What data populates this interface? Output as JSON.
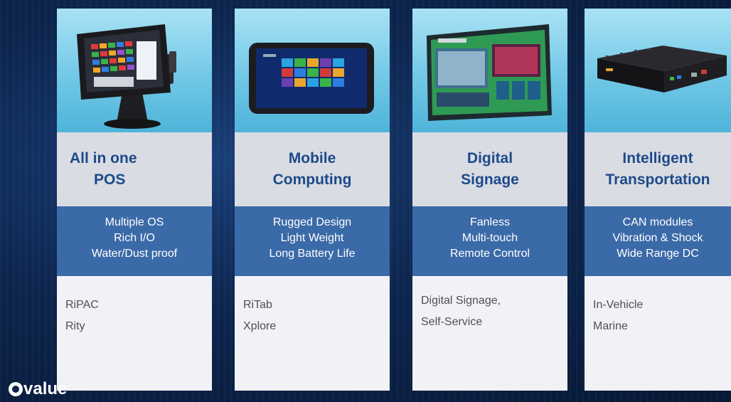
{
  "categories": [
    {
      "id": "pos",
      "image_icon": "pos-terminal-icon",
      "title_lines": [
        "All in one",
        "POS"
      ],
      "features": [
        "Multiple OS",
        "Rich I/O",
        "Water/Dust proof"
      ],
      "product_lines": [
        "RiPAC",
        "Rity"
      ]
    },
    {
      "id": "mobile",
      "image_icon": "rugged-tablet-icon",
      "title_lines": [
        "Mobile",
        "Computing"
      ],
      "features": [
        "Rugged Design",
        "Light Weight",
        "Long Battery Life"
      ],
      "product_lines": [
        "RiTab",
        "Xplore"
      ]
    },
    {
      "id": "signage",
      "image_icon": "digital-signage-display-icon",
      "title_lines": [
        "Digital",
        "Signage"
      ],
      "features": [
        "Fanless",
        "Multi-touch",
        "Remote Control"
      ],
      "product_lines": [
        "Digital Signage,",
        "Self-Service"
      ]
    },
    {
      "id": "transport",
      "image_icon": "embedded-box-pc-icon",
      "title_lines": [
        "Intelligent",
        "Transportation"
      ],
      "features": [
        "CAN modules",
        "Vibration & Shock",
        "Wide Range DC"
      ],
      "product_lines": [
        "In-Vehicle",
        "Marine"
      ]
    }
  ],
  "logo": {
    "text": "value",
    "icon": "avalue-logo-icon"
  },
  "colors": {
    "background": "#0d254d",
    "title_text": "#1c4a8a",
    "title_bg": "#d9dce3",
    "features_bg": "#3b6aa8",
    "lines_bg": "#f1f2f6",
    "image_bg": "#72c8e6"
  }
}
